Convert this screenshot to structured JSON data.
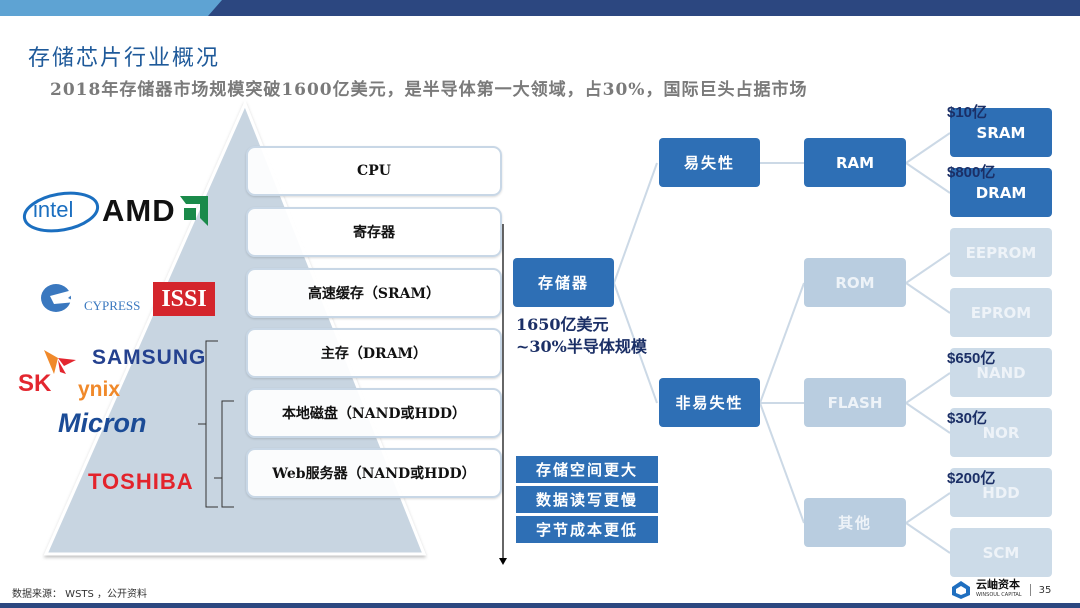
{
  "header": {
    "title": "存储芯片行业概况",
    "subtitle": "2018年存储器市场规模突破1600亿美元，是半导体第一大领域，占30%，国际巨头占据市场",
    "colors": {
      "bar_light": "#5ea3d3",
      "bar_dark": "#2c4780",
      "title": "#1f5a9a"
    }
  },
  "pyramid": {
    "layers": [
      {
        "label": "CPU"
      },
      {
        "label": "寄存器"
      },
      {
        "label": "高速缓存（SRAM）"
      },
      {
        "label": "主存（DRAM）"
      },
      {
        "label": "本地磁盘（NAND或HDD）"
      },
      {
        "label": "Web服务器（NAND或HDD）"
      }
    ]
  },
  "logos": {
    "intel": "intel",
    "amd": "AMD",
    "cypress": "CYPRESS",
    "issi": "ISSI",
    "samsung": "SAMSUNG",
    "sk": "SK",
    "hynix": "ynix",
    "micron": "Micron",
    "toshiba": "TOSHIBA"
  },
  "tree": {
    "root": {
      "label": "存储器"
    },
    "market_note": [
      "1650亿美元",
      "~30%半导体规模"
    ],
    "volatile": {
      "label": "易失性"
    },
    "nonvolatile": {
      "label": "非易失性"
    },
    "ram": {
      "label": "RAM"
    },
    "rom": {
      "label": "ROM"
    },
    "flash": {
      "label": "FLASH"
    },
    "other": {
      "label": "其他"
    },
    "leaves": [
      {
        "label": "SRAM",
        "price": "$10亿"
      },
      {
        "label": "DRAM",
        "price": "$800亿"
      },
      {
        "label": "EEPROM",
        "price": ""
      },
      {
        "label": "EPROM",
        "price": ""
      },
      {
        "label": "NAND",
        "price": "$650亿"
      },
      {
        "label": "NOR",
        "price": "$30亿"
      },
      {
        "label": "HDD",
        "price": "$200亿"
      },
      {
        "label": "SCM",
        "price": ""
      }
    ]
  },
  "features": [
    "存储空间更大",
    "数据读写更慢",
    "字节成本更低"
  ],
  "footer": {
    "source": "数据来源： WSTS ，公开资料",
    "brand_cn": "云岫资本",
    "brand_en": "WINSOUL CAPITAL",
    "page": "35"
  }
}
